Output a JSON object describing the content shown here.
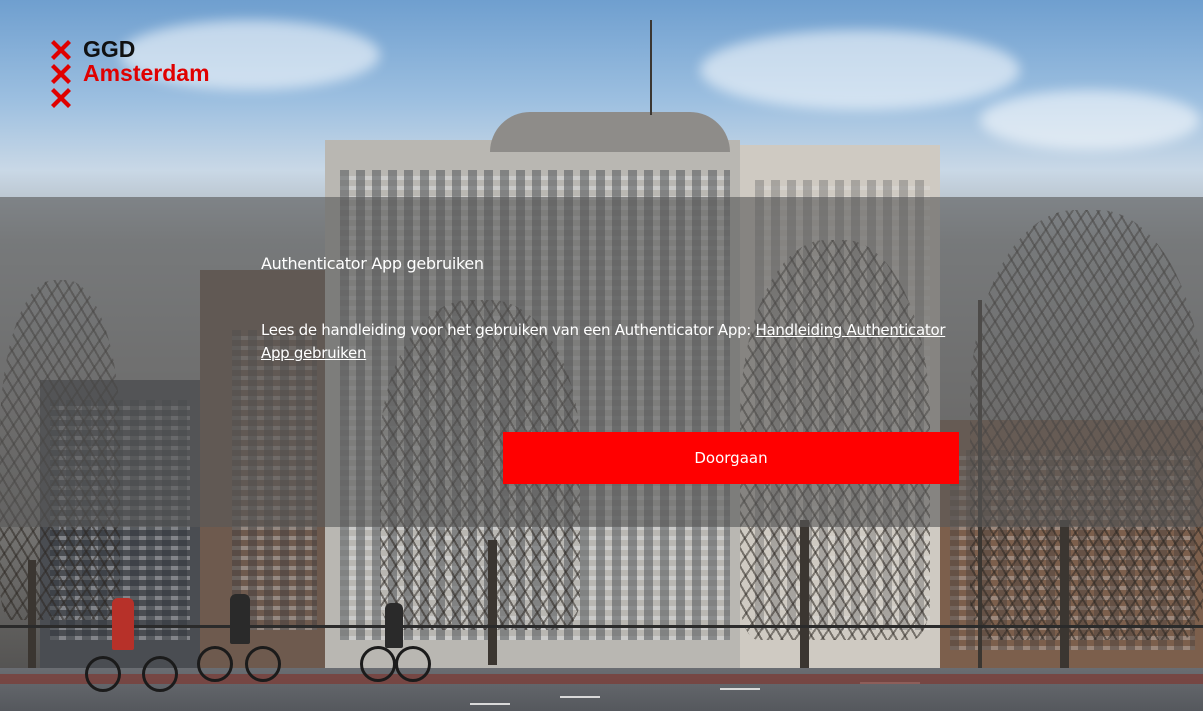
{
  "brand": {
    "logo_lines": [
      "GGD",
      "Amsterdam",
      ""
    ],
    "logo_colors": [
      "#111111",
      "#e00000",
      "#e00000"
    ],
    "cross_color": "#e00000"
  },
  "panel": {
    "title": "Authenticator App gebruiken",
    "body_text": "Lees de handleiding voor het gebruiken van een Authenticator App: ",
    "link_text": "Handleiding Authenticator App gebruiken",
    "button_label": "Doorgaan"
  },
  "colors": {
    "accent": "#ff0000",
    "panel_overlay": "#585858"
  },
  "icons": {
    "logo": "amsterdam-x-cross-icon"
  }
}
